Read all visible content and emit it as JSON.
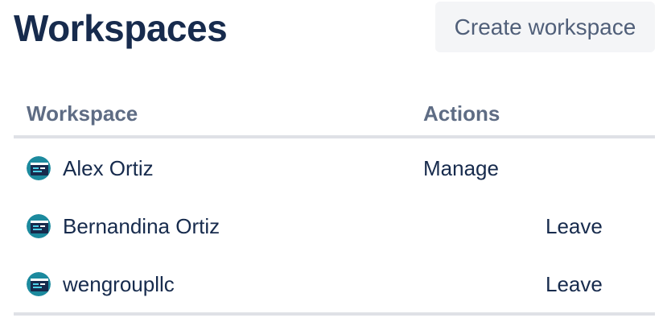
{
  "header": {
    "title": "Workspaces",
    "create_button_label": "Create workspace"
  },
  "table": {
    "columns": [
      "Workspace",
      "Actions"
    ],
    "rows": [
      {
        "name": "Alex Ortiz",
        "action": "Manage",
        "avatar_icon": "workspace-avatar-icon"
      },
      {
        "name": "Bernandina Ortiz",
        "action": "Leave",
        "avatar_icon": "workspace-avatar-icon"
      },
      {
        "name": "wengroupllc",
        "action": "Leave",
        "avatar_icon": "workspace-avatar-icon"
      }
    ]
  },
  "colors": {
    "title": "#172b4d",
    "button_bg": "#f4f5f7",
    "button_text": "#505f79",
    "header_text": "#5e6c84",
    "divider": "#dfe1e6",
    "avatar_teal": "#1c8a9e",
    "avatar_dark": "#172b4d"
  }
}
